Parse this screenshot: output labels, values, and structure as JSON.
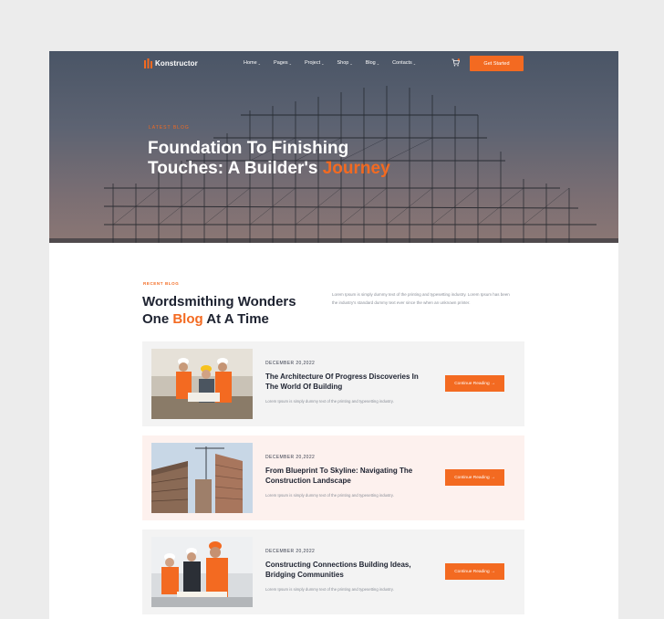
{
  "colors": {
    "accent": "#f36a21",
    "background": "#ececec",
    "card_gray": "#f3f3f3",
    "card_pink": "#fdf1ee",
    "heading": "#1d2230"
  },
  "nav": {
    "brand": "Konstructor",
    "brand_icon": "building-bars-icon",
    "menu": [
      {
        "label": "Home"
      },
      {
        "label": "Pages"
      },
      {
        "label": "Project"
      },
      {
        "label": "Shop"
      },
      {
        "label": "Blog"
      },
      {
        "label": "Contacts"
      }
    ],
    "cart_icon": "cart-icon",
    "cta_label": "Get Started"
  },
  "hero": {
    "eyebrow": "LATEST BLOG",
    "title_line1": "Foundation To Finishing",
    "title_line2_prefix": "Touches: A Builder's ",
    "title_accent": "Journey"
  },
  "recent": {
    "eyebrow": "RECENT BLOG",
    "title_line1": "Wordsmithing Wonders",
    "title_line2_prefix": "One ",
    "title_accent": "Blog",
    "title_line2_suffix": " At A Time",
    "description": "Lorem Ipsum is simply dummy text of the printing and typesetting industry. Lorem Ipsum has been the industry's standard dummy text ever since the when an unknown printer."
  },
  "posts": [
    {
      "date": "DECEMBER 20,2022",
      "title": "The Architecture Of Progress Discoveries In The World Of Building",
      "excerpt": "Lorem Ipsum is simply dummy text of the printing and typesetting industry.",
      "button": "Continue Reading →"
    },
    {
      "date": "DECEMBER 20,2022",
      "title": "From Blueprint To Skyline: Navigating The Construction Landscape",
      "excerpt": "Lorem Ipsum is simply dummy text of the printing and typesetting industry.",
      "button": "Continue Reading →"
    },
    {
      "date": "DECEMBER 20,2022",
      "title": "Constructing Connections Building Ideas, Bridging Communities",
      "excerpt": "Lorem Ipsum is simply dummy text of the printing and typesetting industry.",
      "button": "Continue Reading →"
    }
  ]
}
